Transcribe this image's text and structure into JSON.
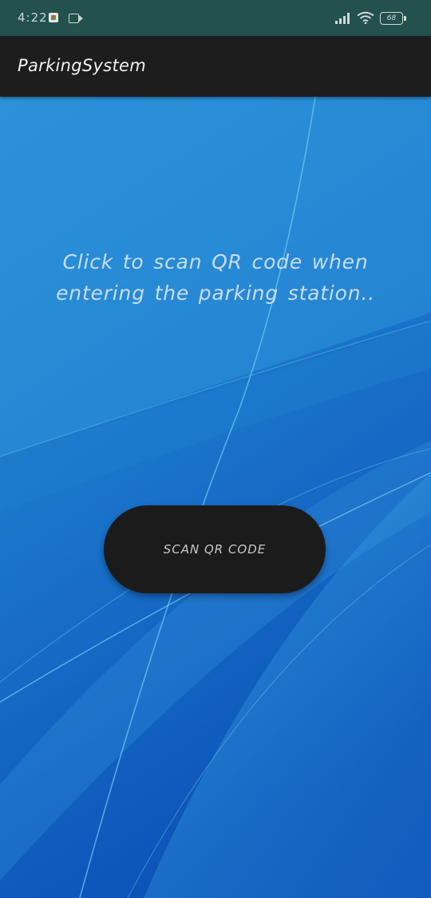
{
  "status_bar": {
    "time": "4:22",
    "battery_level": "68",
    "icons": [
      "google-app-icon",
      "video-icon",
      "signal-icon",
      "wifi-icon",
      "battery-icon"
    ]
  },
  "app_bar": {
    "title": "ParkingSystem"
  },
  "main": {
    "prompt": "Click to scan QR code when entering the parking station..",
    "scan_button_label": "SCAN QR CODE"
  },
  "colors": {
    "status_bar_bg": "#23514d",
    "app_bar_bg": "#1d1d1d",
    "background_light": "#2a8fd6",
    "background_dark": "#0c53b8",
    "button_bg": "#1b1b1c",
    "prompt_text": "#c9dcec"
  }
}
